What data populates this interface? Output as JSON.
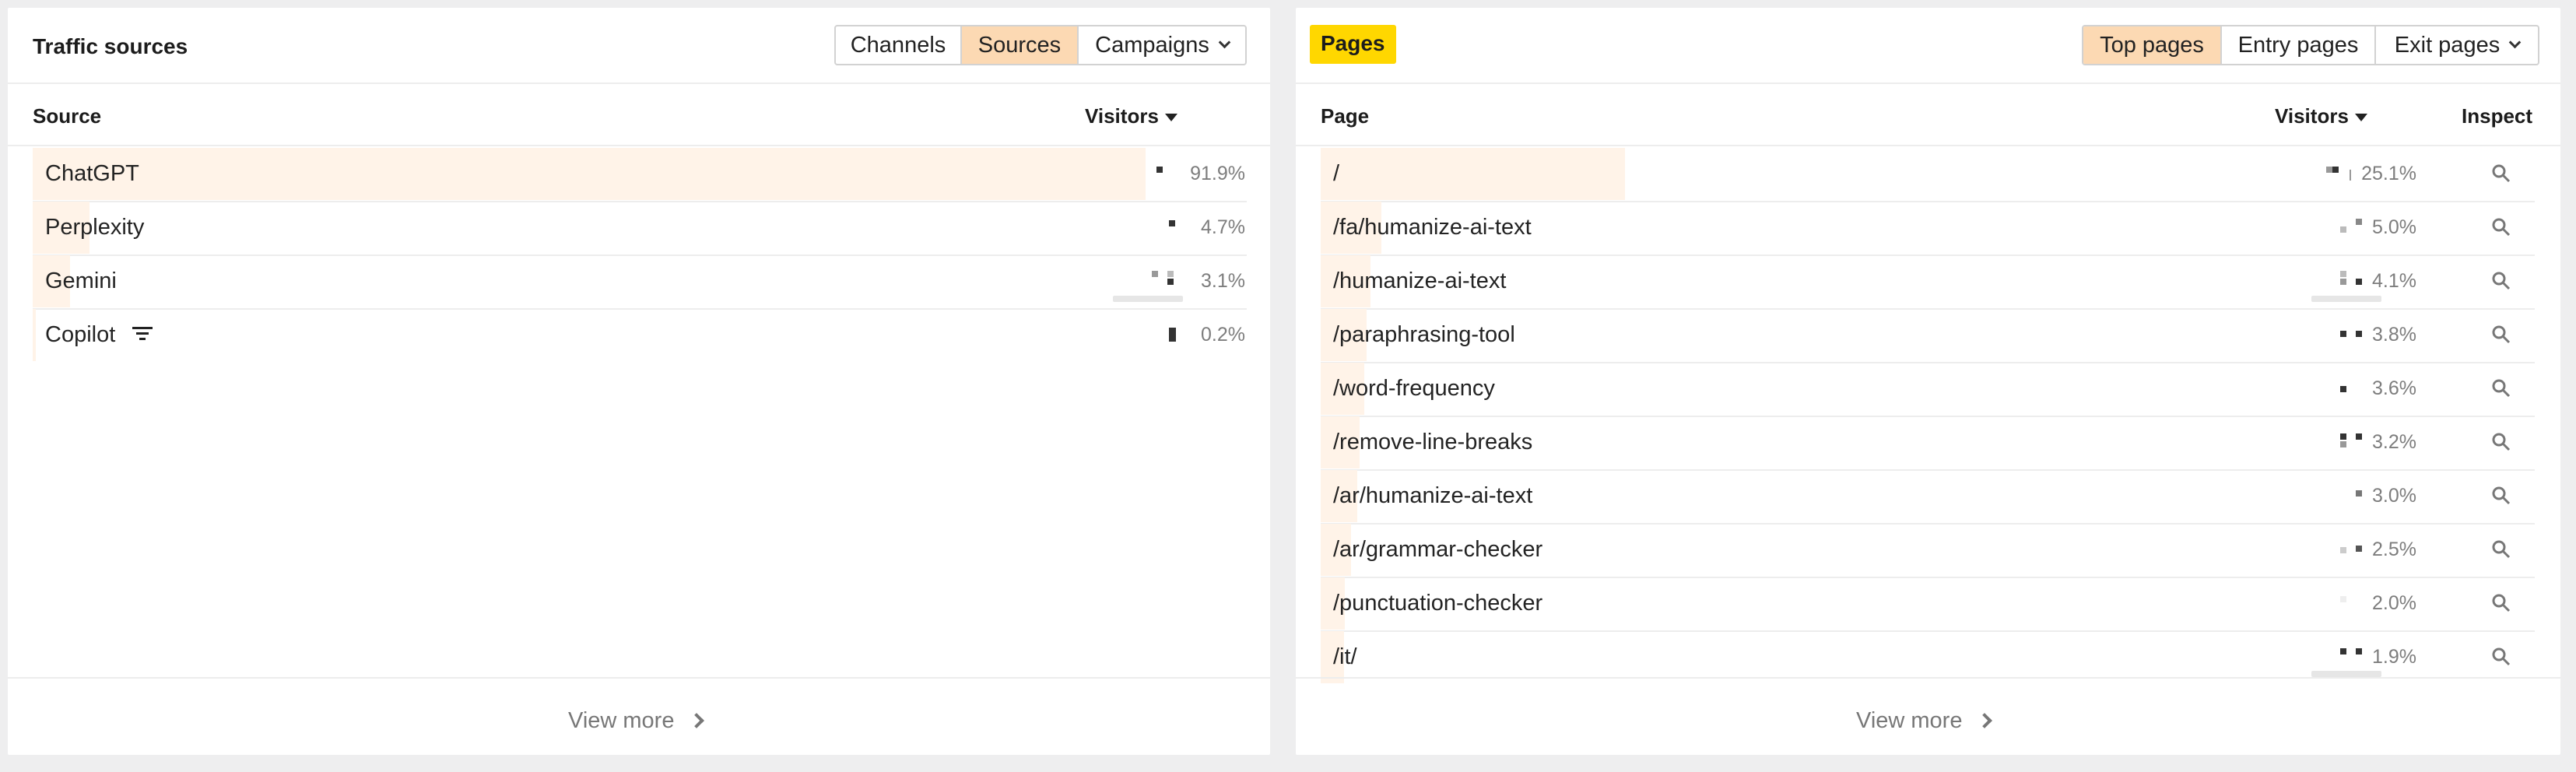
{
  "traffic_sources": {
    "title": "Traffic sources",
    "tabs": [
      {
        "label": "Channels",
        "active": false
      },
      {
        "label": "Sources",
        "active": true
      },
      {
        "label": "Campaigns",
        "active": false,
        "dropdown": true
      }
    ],
    "columns": {
      "source": "Source",
      "visitors": "Visitors"
    },
    "rows": [
      {
        "label": "ChatGPT",
        "percent": "91.9%",
        "share": 0.919
      },
      {
        "label": "Perplexity",
        "percent": "4.7%",
        "share": 0.047
      },
      {
        "label": "Gemini",
        "percent": "3.1%",
        "share": 0.031
      },
      {
        "label": "Copilot",
        "percent": "0.2%",
        "share": 0.002,
        "icon": "filter-icon"
      }
    ],
    "view_more": "View more"
  },
  "pages": {
    "title": "Pages",
    "title_highlight_color": "#ffd700",
    "tabs": [
      {
        "label": "Top pages",
        "active": true
      },
      {
        "label": "Entry pages",
        "active": false
      },
      {
        "label": "Exit pages",
        "active": false,
        "dropdown": true
      }
    ],
    "columns": {
      "page": "Page",
      "visitors": "Visitors",
      "inspect": "Inspect"
    },
    "rows": [
      {
        "label": "/",
        "percent": "25.1%",
        "share": 0.251
      },
      {
        "label": "/fa/humanize-ai-text",
        "percent": "5.0%",
        "share": 0.05
      },
      {
        "label": "/humanize-ai-text",
        "percent": "4.1%",
        "share": 0.041
      },
      {
        "label": "/paraphrasing-tool",
        "percent": "3.8%",
        "share": 0.038
      },
      {
        "label": "/word-frequency",
        "percent": "3.6%",
        "share": 0.036
      },
      {
        "label": "/remove-line-breaks",
        "percent": "3.2%",
        "share": 0.032
      },
      {
        "label": "/ar/humanize-ai-text",
        "percent": "3.0%",
        "share": 0.03
      },
      {
        "label": "/ar/grammar-checker",
        "percent": "2.5%",
        "share": 0.025
      },
      {
        "label": "/punctuation-checker",
        "percent": "2.0%",
        "share": 0.02
      },
      {
        "label": "/it/",
        "percent": "1.9%",
        "share": 0.019
      }
    ],
    "view_more": "View more"
  },
  "colors": {
    "active_tab": "#fcd9b3",
    "row_bar": "#fff3e8",
    "title_highlight": "#ffd700"
  }
}
